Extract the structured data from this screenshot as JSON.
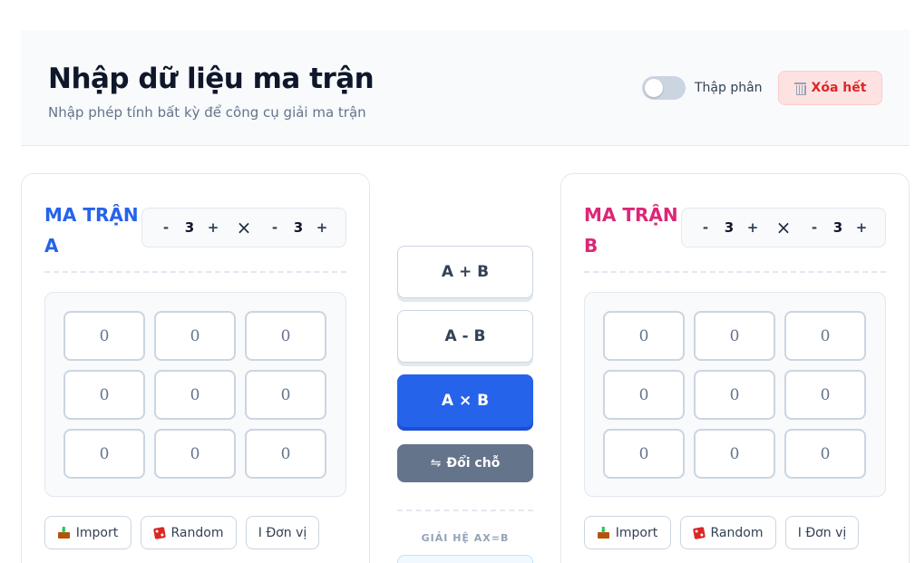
{
  "header": {
    "title": "Nhập dữ liệu ma trận",
    "subtitle": "Nhập phép tính bất kỳ để công cụ giải ma trận",
    "decimal_toggle": {
      "label": "Thập phân",
      "on": false
    },
    "clear_button": {
      "label": "Xóa hết",
      "icon": "trash-icon"
    }
  },
  "matrix_a": {
    "title": "MA TRẬN A",
    "color": "#2563eb",
    "rows": "3",
    "cols": "3",
    "minus": "-",
    "plus": "+",
    "times": "×",
    "cells": [
      [
        "0",
        "0",
        "0"
      ],
      [
        "0",
        "0",
        "0"
      ],
      [
        "0",
        "0",
        "0"
      ]
    ],
    "buttons": {
      "import": "Import",
      "random": "Random",
      "identity": "I Đơn vị"
    }
  },
  "matrix_b": {
    "title": "MA TRẬN B",
    "color": "#db2777",
    "rows": "3",
    "cols": "3",
    "minus": "-",
    "plus": "+",
    "times": "×",
    "cells": [
      [
        "0",
        "0",
        "0"
      ],
      [
        "0",
        "0",
        "0"
      ],
      [
        "0",
        "0",
        "0"
      ]
    ],
    "buttons": {
      "import": "Import",
      "random": "Random",
      "identity": "I Đơn vị"
    }
  },
  "operations": {
    "add": "A + B",
    "subtract": "A - B",
    "multiply": "A × B",
    "active": "multiply",
    "active_color": "#2563eb",
    "swap": "Đổi chỗ",
    "swap_icon": "⇋",
    "solve_label": "GIẢI HỆ AX=B"
  }
}
